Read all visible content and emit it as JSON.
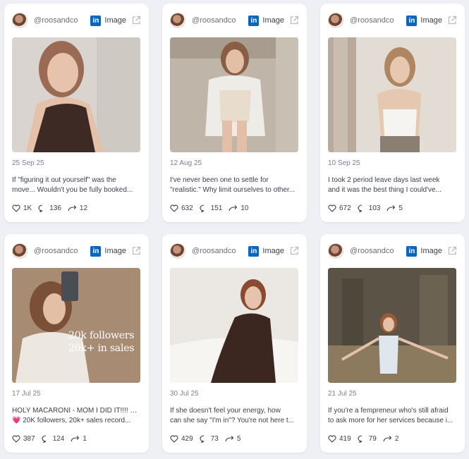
{
  "posts": [
    {
      "handle": "@roosandco",
      "network_badge": "in",
      "media_type": "Image",
      "date": "25 Sep 25",
      "caption_line1": "If \"figuring it out yourself\" was the",
      "caption_line2": "move... Wouldn't you be fully booked...",
      "likes": "1K",
      "comments": "136",
      "reposts": "12"
    },
    {
      "handle": "@roosandco",
      "network_badge": "in",
      "media_type": "Image",
      "date": "12 Aug 25",
      "caption_line1": "I've never been one to settle for",
      "caption_line2": "\"realistic.\" Why limit ourselves to other...",
      "likes": "632",
      "comments": "151",
      "reposts": "10"
    },
    {
      "handle": "@roosandco",
      "network_badge": "in",
      "media_type": "Image",
      "date": "10 Sep 25",
      "caption_line1": "I took 2 period leave days last week",
      "caption_line2": "and it was the best thing I could've...",
      "likes": "672",
      "comments": "103",
      "reposts": "5"
    },
    {
      "handle": "@roosandco",
      "network_badge": "in",
      "media_type": "Image",
      "date": "17 Jul 25",
      "caption_line1": "HOLY MACARONI - MOM I DID IT!!!! 😆 😭",
      "caption_line2": "💗 20K followers, 20k+ sales record...",
      "likes": "387",
      "comments": "124",
      "reposts": "1",
      "image_overlay_line1": "20k followers",
      "image_overlay_line2": "20k+ in sales"
    },
    {
      "handle": "@roosandco",
      "network_badge": "in",
      "media_type": "Image",
      "date": "30 Jul 25",
      "caption_line1": "If she doesn't feel your energy, how",
      "caption_line2": "can she say \"I'm in\"? You're not here t...",
      "likes": "429",
      "comments": "73",
      "reposts": "5"
    },
    {
      "handle": "@roosandco",
      "network_badge": "in",
      "media_type": "Image",
      "date": "21 Jul 25",
      "caption_line1": "If you're a fempreneur who's still afraid",
      "caption_line2": "to ask more for her services because i...",
      "likes": "419",
      "comments": "79",
      "reposts": "2"
    }
  ],
  "colors": {
    "linkedin_blue": "#0a66c2",
    "card_bg": "#ffffff",
    "page_bg": "#eef0f5"
  },
  "icons": [
    "avatar",
    "linkedin-icon",
    "external-link-icon",
    "heart-icon",
    "comment-icon",
    "repost-icon"
  ]
}
